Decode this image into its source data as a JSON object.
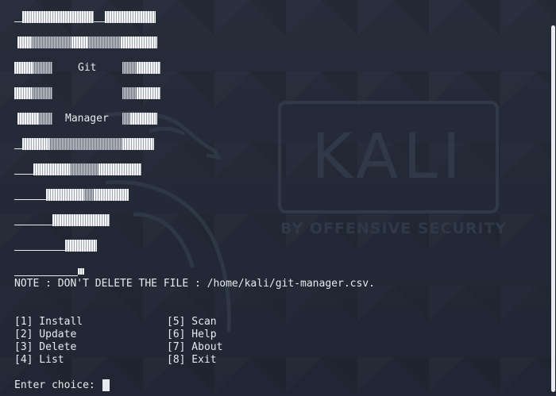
{
  "banner": {
    "word1": "Git",
    "word2": "Manager"
  },
  "note": "NOTE : DON'T DELETE THE FILE : /home/kali/git-manager.csv.",
  "menu": {
    "left": [
      "[1] Install",
      "[2] Update",
      "[3] Delete",
      "[4] List"
    ],
    "right": [
      "[5] Scan",
      "[6] Help",
      "[7] About",
      "[8] Exit"
    ]
  },
  "prompt": "Enter choice: ",
  "wallpaper": {
    "logo_text": "KALI",
    "tagline": "BY OFFENSIVE SECURITY"
  },
  "colors": {
    "background": "#232936",
    "foreground": "#e6e9ee",
    "wallpaper_mark": "#313847"
  }
}
